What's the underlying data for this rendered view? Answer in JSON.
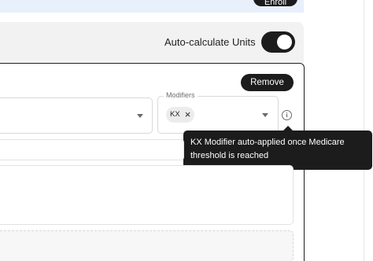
{
  "banner": {
    "enroll_label": "Enroll"
  },
  "auto_calculate": {
    "label": "Auto-calculate Units",
    "enabled": true
  },
  "card": {
    "remove_label": "Remove",
    "modifiers": {
      "label": "Modifiers",
      "chips": [
        {
          "label": "KX"
        }
      ]
    },
    "tooltip": "KX Modifier auto-applied once Medicare threshold is reached"
  },
  "colors": {
    "primary_dark": "#1c1c1c",
    "banner_bg": "#e8f0fb",
    "row_bg": "#f2f2f2"
  },
  "icons": [
    "chevron-down-icon",
    "close-icon",
    "info-icon"
  ]
}
